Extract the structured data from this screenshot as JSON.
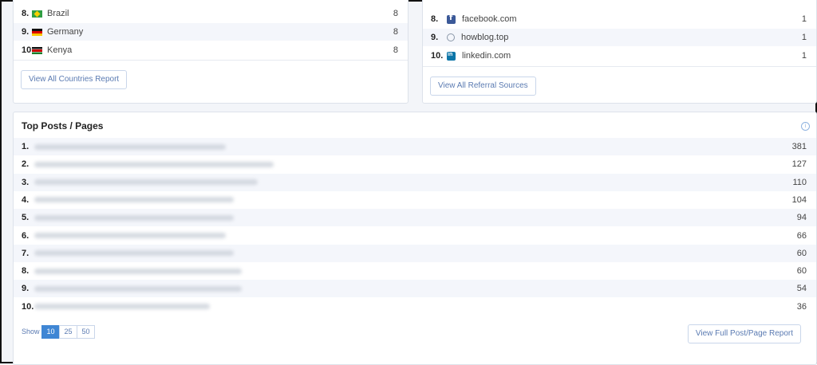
{
  "countries": {
    "rows": [
      {
        "rank": "8.",
        "flag": "flag-br",
        "name": "Brazil",
        "value": "8"
      },
      {
        "rank": "9.",
        "flag": "flag-de",
        "name": "Germany",
        "value": "8"
      },
      {
        "rank": "10.",
        "flag": "flag-ke",
        "name": "Kenya",
        "value": "8"
      }
    ],
    "button_label": "View All Countries Report"
  },
  "referrals": {
    "rows": [
      {
        "rank": "8.",
        "icon": "facebook-icon",
        "name": "facebook.com",
        "value": "1"
      },
      {
        "rank": "9.",
        "icon": "globe-icon",
        "name": "howblog.top",
        "value": "1"
      },
      {
        "rank": "10.",
        "icon": "linkedin-icon",
        "name": "linkedin.com",
        "value": "1"
      }
    ],
    "button_label": "View All Referral Sources"
  },
  "posts": {
    "title": "Top Posts / Pages",
    "rows": [
      {
        "rank": "1.",
        "value": "381"
      },
      {
        "rank": "2.",
        "value": "127"
      },
      {
        "rank": "3.",
        "value": "110"
      },
      {
        "rank": "4.",
        "value": "104"
      },
      {
        "rank": "5.",
        "value": "94"
      },
      {
        "rank": "6.",
        "value": "66"
      },
      {
        "rank": "7.",
        "value": "60"
      },
      {
        "rank": "8.",
        "value": "60"
      },
      {
        "rank": "9.",
        "value": "54"
      },
      {
        "rank": "10.",
        "value": "36"
      }
    ],
    "show_label": "Show",
    "page_sizes": [
      "10",
      "25",
      "50"
    ],
    "active_page_size": "10",
    "button_label": "View Full Post/Page Report"
  },
  "colors": {
    "accent": "#3f86d4",
    "link": "#5b7bb2",
    "row_alt": "#f4f6fb"
  }
}
